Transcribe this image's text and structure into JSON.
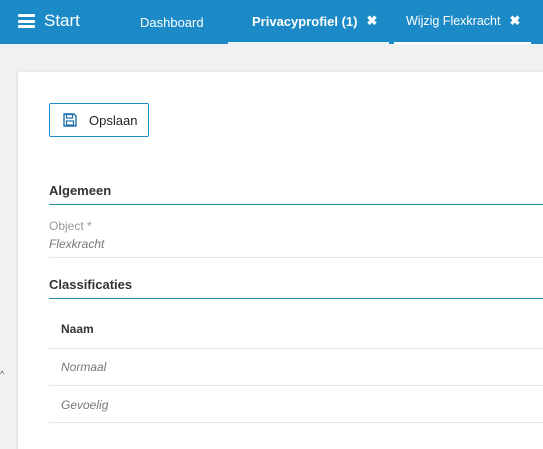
{
  "header": {
    "menu_label": "Start",
    "accent_color": "#1b8ac7",
    "tabs": [
      {
        "label": "Dashboard",
        "closable": false,
        "active": false
      },
      {
        "label": "Privacyprofiel (1)",
        "closable": true,
        "close_icon": "✖",
        "active": false
      },
      {
        "label": "Wijzig Flexkracht",
        "closable": true,
        "close_icon": "✖",
        "active": true
      }
    ]
  },
  "toolbar": {
    "save_label": "Opslaan",
    "save_icon": "floppy-disk-icon"
  },
  "algemeen": {
    "title": "Algemeen",
    "object_label": "Object *",
    "object_value": "Flexkracht"
  },
  "classificaties": {
    "title": "Classificaties",
    "column_header": "Naam",
    "rows": [
      "Normaal",
      "Gevoelig"
    ]
  }
}
